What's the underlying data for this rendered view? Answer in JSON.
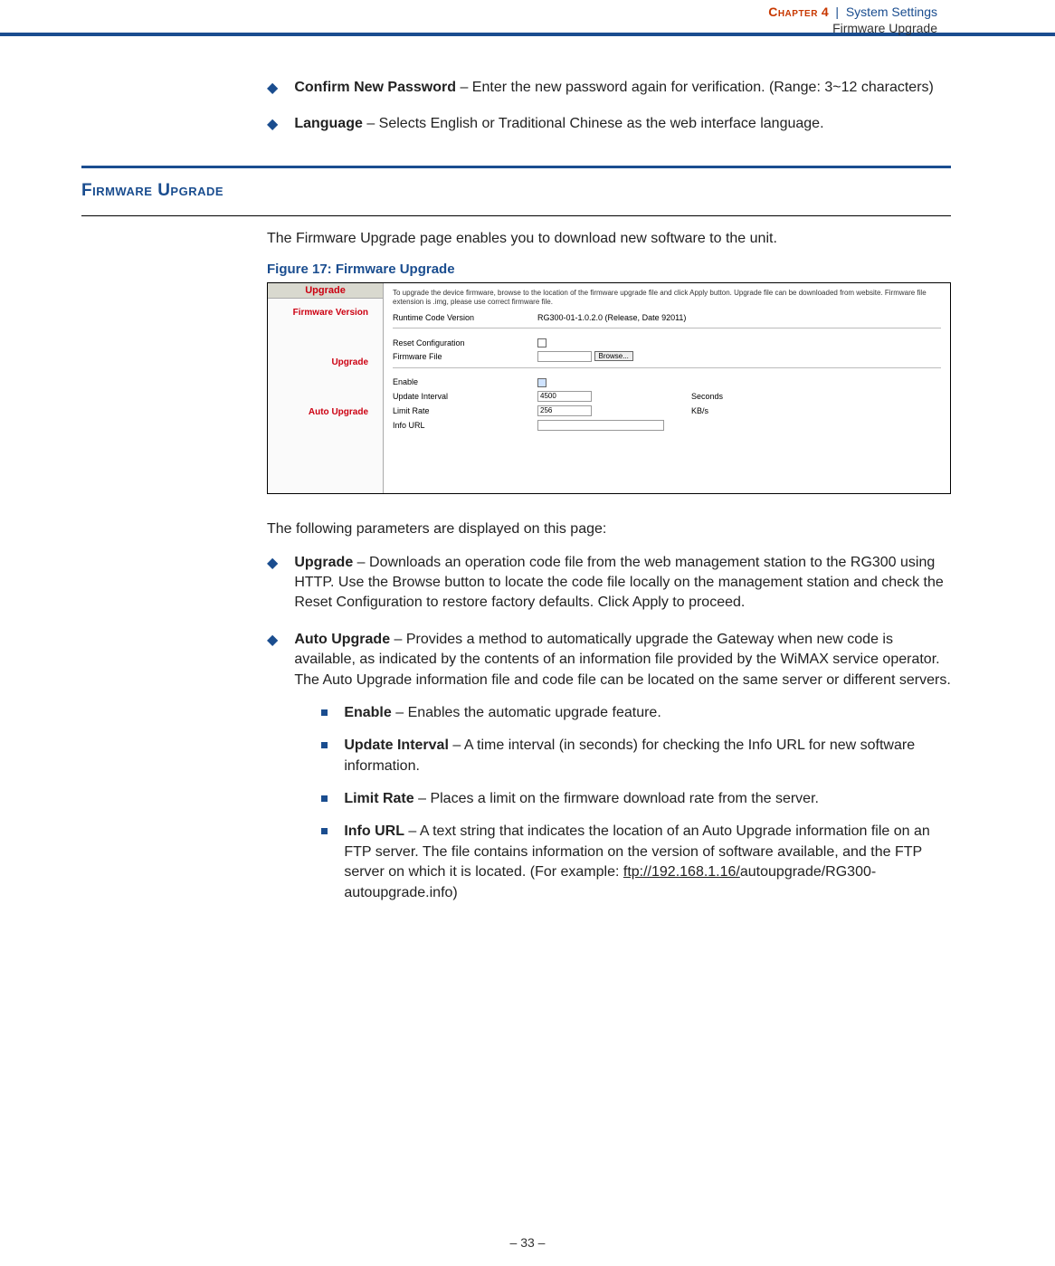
{
  "header": {
    "chapter_label": "Chapter",
    "chapter_no": "4",
    "separator": "|",
    "section": "System Settings",
    "subsection": "Firmware Upgrade"
  },
  "bullets_top": [
    {
      "term": "Confirm New Password",
      "desc": " – Enter the new password again for verification. (Range: 3~12 characters)"
    },
    {
      "term": "Language",
      "desc": " – Selects English or Traditional Chinese as the web interface language."
    }
  ],
  "section_title": "Firmware Upgrade",
  "intro": "The Firmware Upgrade page enables you to download new software to the unit.",
  "figure_caption": "Figure 17:  Firmware Upgrade",
  "screenshot": {
    "side_title": "Upgrade",
    "nav": [
      "Firmware Version",
      "Upgrade",
      "Auto Upgrade"
    ],
    "desc": "To upgrade the device firmware, browse to the location of the firmware upgrade file and click Apply button. Upgrade file can be downloaded from website. Firmware file extension is .img, please use correct firmware file.",
    "rows": {
      "runtime_label": "Runtime Code Version",
      "runtime_value": "RG300-01-1.0.2.0 (Release, Date 92011)",
      "reset_label": "Reset Configuration",
      "file_label": "Firmware File",
      "browse_btn": "Browse...",
      "enable_label": "Enable",
      "interval_label": "Update Interval",
      "interval_value": "4500",
      "interval_unit": "Seconds",
      "limit_label": "Limit Rate",
      "limit_value": "256",
      "limit_unit": "KB/s",
      "info_label": "Info URL"
    }
  },
  "params_intro": "The following parameters are displayed on this page:",
  "params": [
    {
      "term": "Upgrade",
      "desc": " – Downloads an operation code file from the web management station to the RG300 using HTTP. Use the Browse button to locate the code file locally on the management station and check the Reset Configuration to restore factory defaults. Click Apply to proceed."
    },
    {
      "term": "Auto Upgrade",
      "desc": " – Provides a method to automatically upgrade the Gateway when new code is available, as indicated by the contents of an information file provided by the WiMAX service operator. The Auto Upgrade information file and code file can be located on the same server or different servers."
    }
  ],
  "subparams": [
    {
      "term": "Enable",
      "desc": " – Enables the automatic upgrade feature."
    },
    {
      "term": "Update Interval",
      "desc": " – A time interval (in seconds) for checking the Info URL for new software information."
    },
    {
      "term": "Limit Rate",
      "desc": " – Places a limit on the firmware download rate from the server."
    },
    {
      "term": "Info URL",
      "desc_pre": " – A text string that indicates the location of an Auto Upgrade information file on an FTP server. The file contains information on the version of software available, and the FTP server on which it is located. (For example: ",
      "link": "ftp://192.168.1.16/",
      "desc_post": "autoupgrade/RG300-autoupgrade.info)"
    }
  ],
  "footer": "–  33  –"
}
